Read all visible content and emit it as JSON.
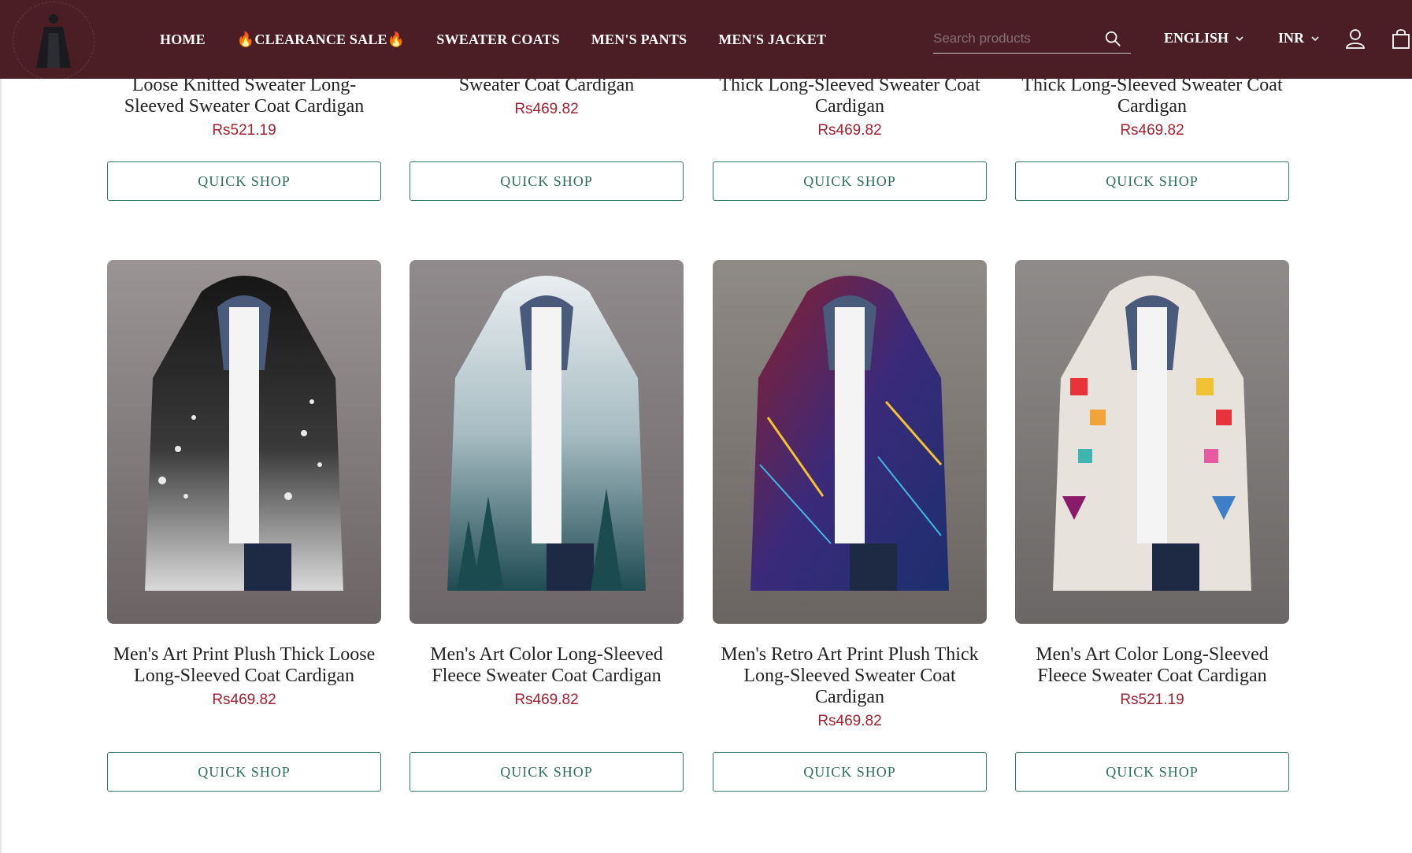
{
  "header": {
    "nav": [
      "HOME",
      "🔥CLEARANCE SALE🔥",
      "SWEATER COATS",
      "MEN'S PANTS",
      "MEN'S JACKET"
    ],
    "search_placeholder": "Search products",
    "language": "ENGLISH",
    "currency": "INR",
    "icons": {
      "search": "search-icon",
      "user": "user-icon",
      "cart": "shopping-bag-icon",
      "chevron": "chevron-down-icon"
    }
  },
  "top_row": [
    {
      "title": "Loose Knitted Sweater Long-Sleeved Sweater Coat Cardigan",
      "price": "Rs521.19",
      "button": "QUICK SHOP"
    },
    {
      "title": "Sweater Coat Cardigan",
      "price": "Rs469.82",
      "button": "QUICK SHOP"
    },
    {
      "title": "Thick Long-Sleeved Sweater Coat Cardigan",
      "price": "Rs469.82",
      "button": "QUICK SHOP"
    },
    {
      "title": "Thick Long-Sleeved Sweater Coat Cardigan",
      "price": "Rs469.82",
      "button": "QUICK SHOP"
    }
  ],
  "bottom_row": [
    {
      "title": "Men's Art Print Plush Thick Loose Long-Sleeved Coat Cardigan",
      "price": "Rs469.82",
      "button": "QUICK SHOP"
    },
    {
      "title": "Men's Art Color Long-Sleeved Fleece Sweater Coat Cardigan",
      "price": "Rs469.82",
      "button": "QUICK SHOP"
    },
    {
      "title": "Men's Retro Art Print Plush Thick Long-Sleeved Sweater Coat Cardigan",
      "price": "Rs469.82",
      "button": "QUICK SHOP"
    },
    {
      "title": "Men's Art Color Long-Sleeved Fleece Sweater Coat Cardigan",
      "price": "Rs521.19",
      "button": "QUICK SHOP"
    }
  ],
  "colors": {
    "header_bg": "#4a1e24",
    "price": "#a3202f",
    "button_border": "#2f7a6a"
  }
}
